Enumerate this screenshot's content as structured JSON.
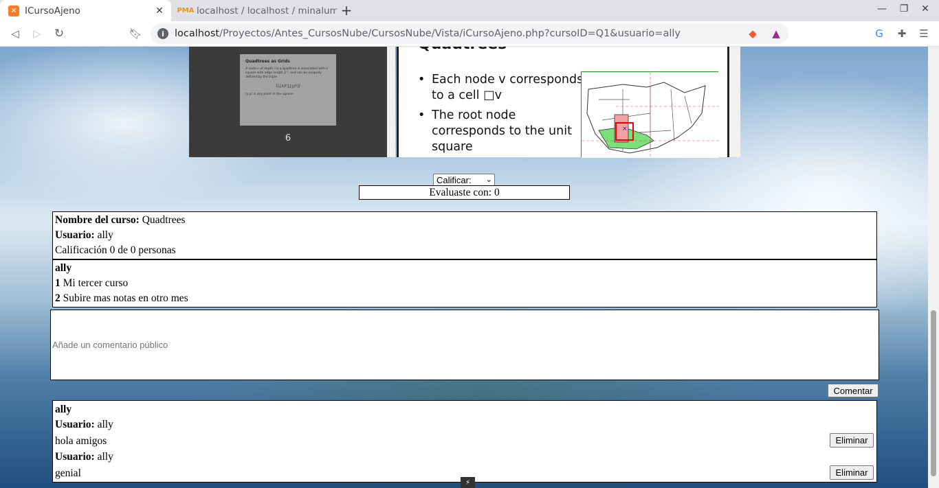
{
  "browser": {
    "tabs": [
      {
        "title": "ICursoAjeno",
        "icon": "xampp-icon",
        "active": true
      },
      {
        "title": "localhost / localhost / minalum",
        "icon": "phpmyadmin-icon",
        "active": false
      }
    ],
    "url_host": "localhost",
    "url_path": "/Proyectos/Antes_CursosNube/CursosNube/Vista/iCursoAjeno.php?cursoID=Q1&usuario=ally"
  },
  "viewer": {
    "thumb_title": "Quadtrees as Grids",
    "thumb_text": "A node v of depth i in a quadtree is associated with a square with edge length 2⁻ⁱ, and can be uniquely defined by the triple",
    "thumb_formula": "(i,⌊x/r⌋,⌊y/r⌋)",
    "thumb_footer": "(x,y) is any point in the square",
    "page_number": "6",
    "slide_title": "Quadtrees",
    "bullets": [
      "Each node v corresponds to a cell □v",
      "The root node corresponds to the unit square"
    ]
  },
  "rating": {
    "select_label": "Calificar:",
    "evaluated_text": "Evaluaste con: 0"
  },
  "course": {
    "name_label": "Nombre del curso:",
    "name_value": "Quadtrees",
    "user_label": "Usuario:",
    "user_value": "ally",
    "rating_summary": "Calificación 0 de 0 personas"
  },
  "notes": {
    "owner": "ally",
    "items": [
      {
        "num": "1",
        "text": "Mi tercer curso"
      },
      {
        "num": "2",
        "text": "Subire mas notas en otro mes"
      }
    ]
  },
  "comment_form": {
    "placeholder": "Añade un comentario público",
    "submit_label": "Comentar"
  },
  "comments": {
    "owner": "ally",
    "user_label": "Usuario:",
    "delete_label": "Eliminar",
    "items": [
      {
        "user": "ally",
        "text": "hola amigos"
      },
      {
        "user": "ally",
        "text": "genial"
      }
    ]
  }
}
